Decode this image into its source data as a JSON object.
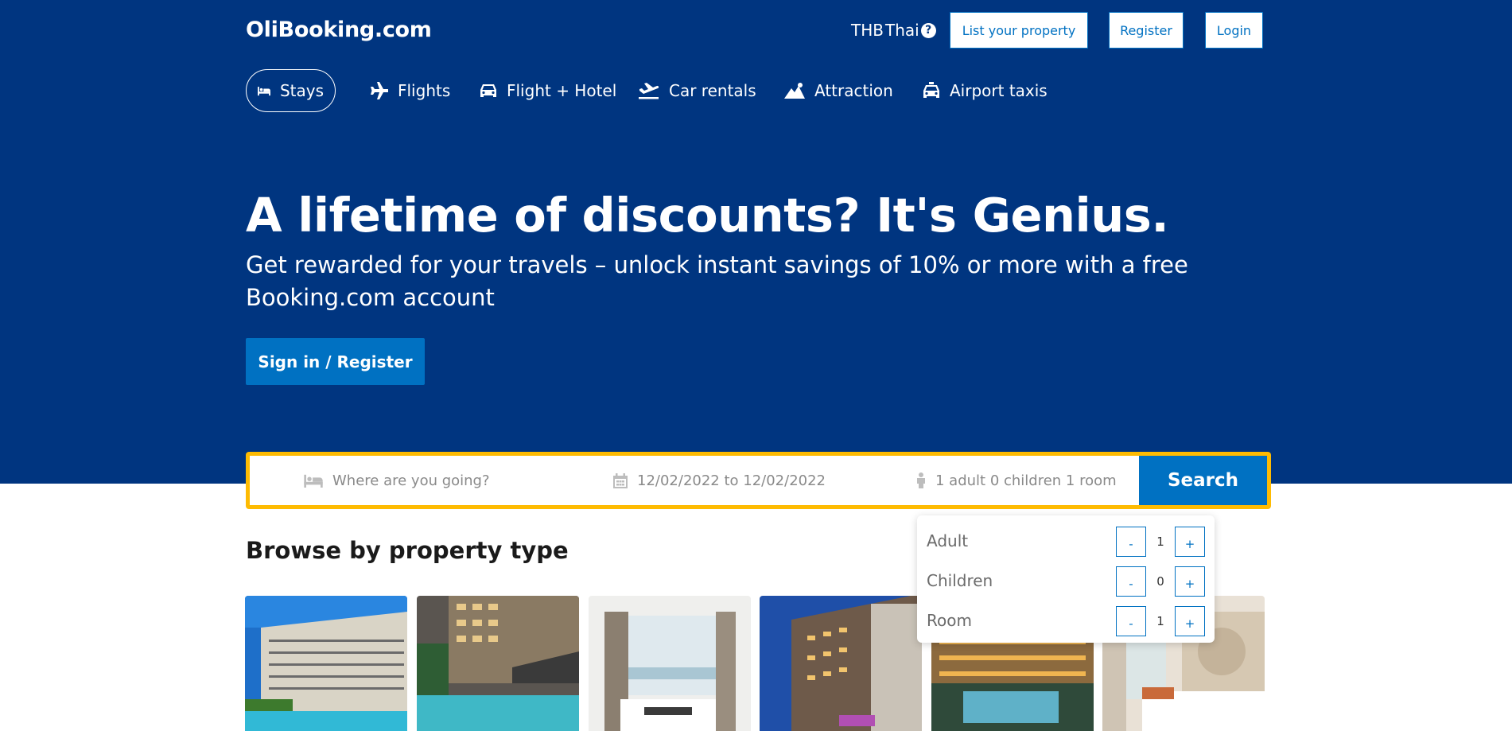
{
  "header": {
    "logo": "OliBooking.com",
    "currency": "THB",
    "language": "Thai",
    "help_icon": "question-circle-icon",
    "list_property": "List your property",
    "register": "Register",
    "login": "Login"
  },
  "nav": {
    "items": [
      {
        "label": "Stays",
        "icon": "bed-icon",
        "active": true
      },
      {
        "label": "Flights",
        "icon": "plane-icon"
      },
      {
        "label": "Flight + Hotel",
        "icon": "car-icon"
      },
      {
        "label": "Car rentals",
        "icon": "plane-departure-icon"
      },
      {
        "label": "Attraction",
        "icon": "mountain-icon"
      },
      {
        "label": "Airport taxis",
        "icon": "taxi-icon"
      }
    ]
  },
  "hero": {
    "title": "A lifetime of discounts? It's Genius.",
    "subtitle": "Get rewarded for your travels – unlock instant savings of 10% or more with a free Booking.com account",
    "cta": "Sign in / Register"
  },
  "search": {
    "destination_placeholder": "Where are you going?",
    "dates": "12/02/2022 to 12/02/2022",
    "guests": "1 adult 0 children 1 room",
    "button": "Search"
  },
  "guests_popup": {
    "rows": [
      {
        "label": "Adult",
        "value": "1"
      },
      {
        "label": "Children",
        "value": "0"
      },
      {
        "label": "Room",
        "value": "1"
      }
    ],
    "minus": "-",
    "plus": "+"
  },
  "browse": {
    "title": "Browse by property type"
  },
  "colors": {
    "brand": "#003580",
    "accent": "#0071c2",
    "highlight": "#febb02"
  }
}
